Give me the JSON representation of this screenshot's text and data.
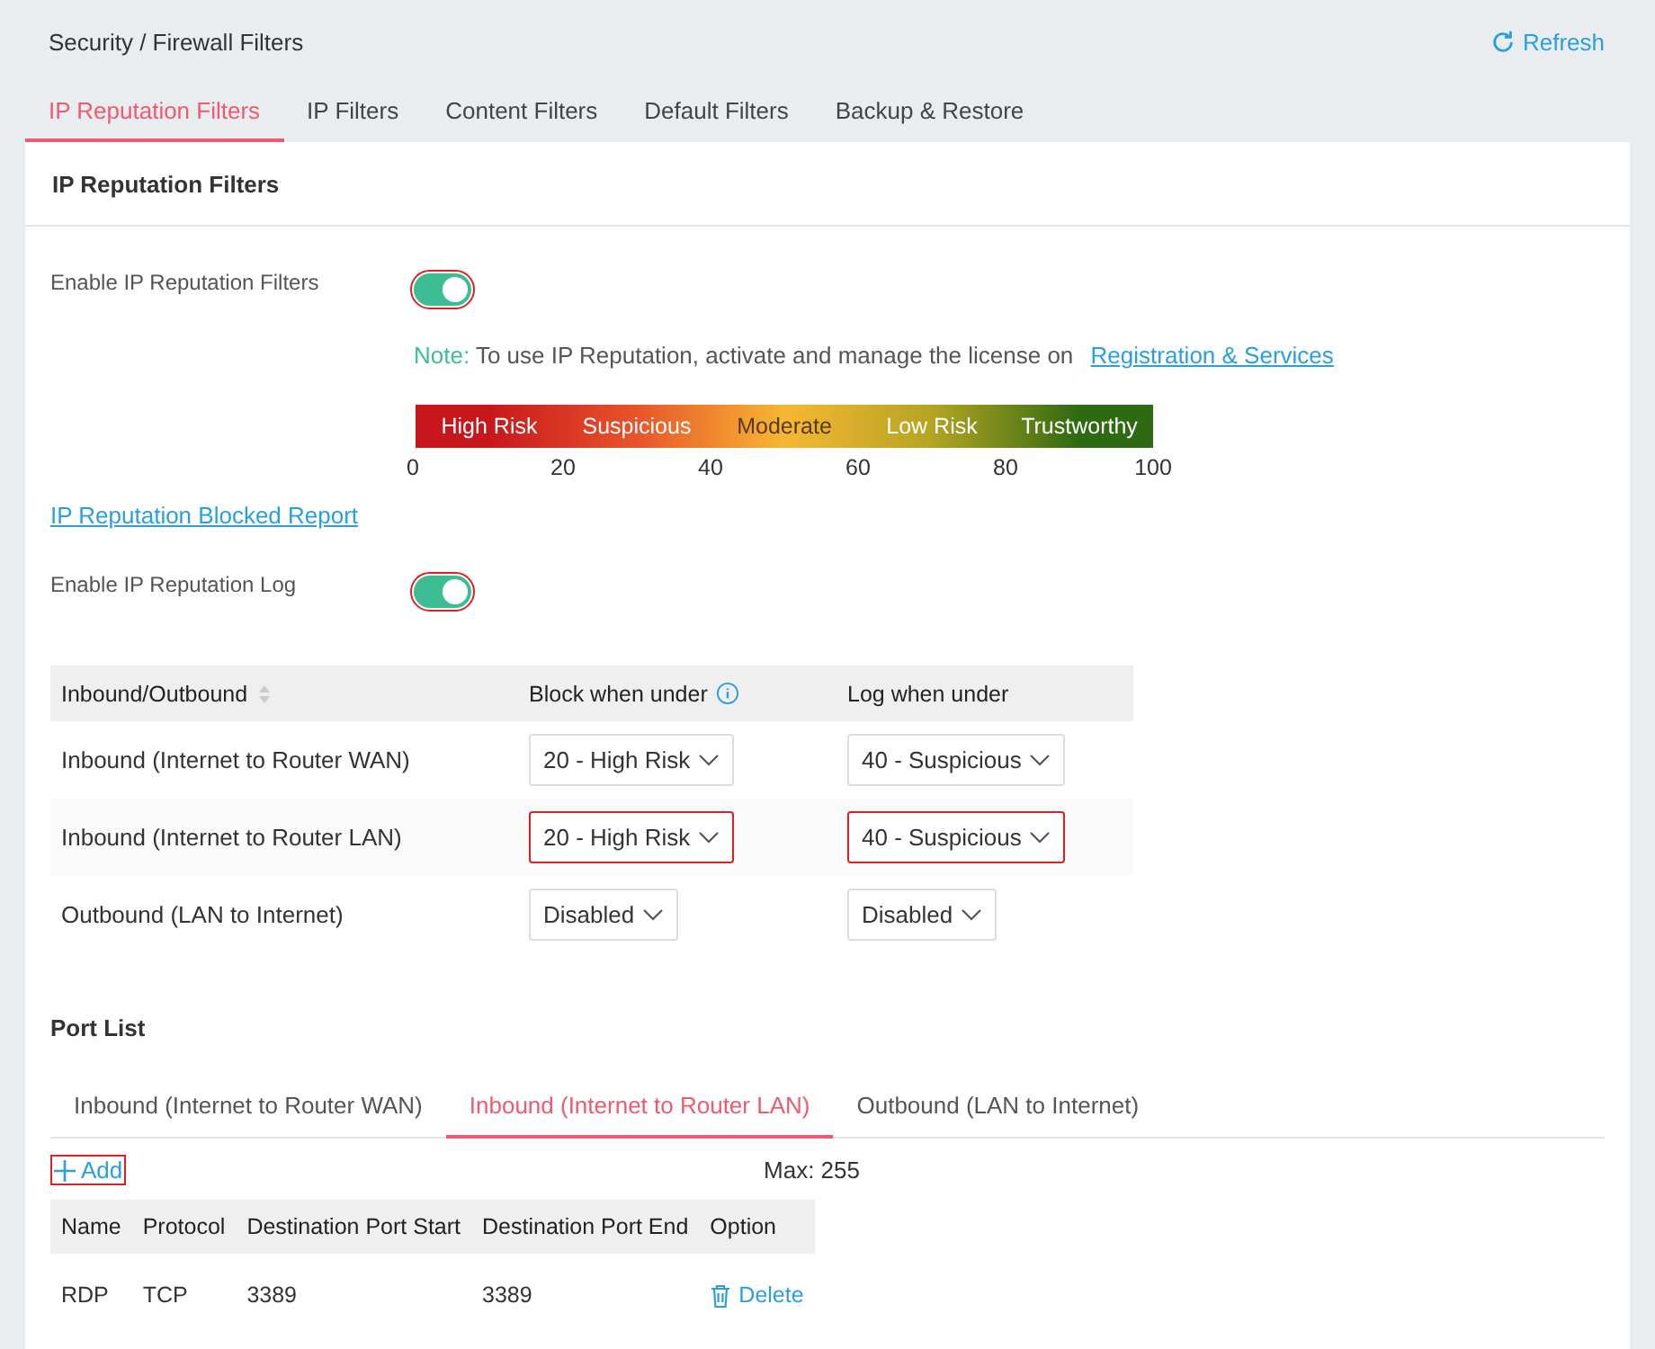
{
  "breadcrumb": "Security / Firewall Filters",
  "refresh": "Refresh",
  "tabs": [
    {
      "label": "IP Reputation Filters",
      "selected": true
    },
    {
      "label": "IP Filters",
      "selected": false
    },
    {
      "label": "Content Filters",
      "selected": false
    },
    {
      "label": "Default Filters",
      "selected": false
    },
    {
      "label": "Backup & Restore",
      "selected": false
    }
  ],
  "panel_title": "IP Reputation Filters",
  "enable_filters": {
    "label": "Enable IP Reputation Filters",
    "on": true,
    "highlighted": true
  },
  "note": {
    "prefix": "Note:",
    "text": "To use IP Reputation, activate and manage the license on",
    "link": "Registration & Services"
  },
  "risk_scale": {
    "segments": [
      {
        "label": "High Risk",
        "color": "#c8161d"
      },
      {
        "label": "Suspicious",
        "color": "#e8542a"
      },
      {
        "label": "Moderate",
        "color": "#f6b733"
      },
      {
        "label": "Low Risk",
        "color": "#b5a423"
      },
      {
        "label": "Trustworthy",
        "color": "#2d6a12"
      }
    ],
    "ticks": [
      "0",
      "20",
      "40",
      "60",
      "80",
      "100"
    ]
  },
  "report_link": "IP Reputation Blocked Report",
  "enable_log": {
    "label": "Enable IP Reputation Log",
    "on": true,
    "highlighted": true
  },
  "rules_table": {
    "columns": [
      "Inbound/Outbound",
      "Block when under",
      "Log when under"
    ],
    "rows": [
      {
        "direction": "Inbound (Internet to Router WAN)",
        "block": {
          "value": "20 - High Risk",
          "highlighted": false
        },
        "log": {
          "value": "40 - Suspicious",
          "highlighted": false
        }
      },
      {
        "direction": "Inbound (Internet to Router LAN)",
        "block": {
          "value": "20 - High Risk",
          "highlighted": true
        },
        "log": {
          "value": "40 - Suspicious",
          "highlighted": true
        }
      },
      {
        "direction": "Outbound (LAN to Internet)",
        "block": {
          "value": "Disabled",
          "highlighted": false
        },
        "log": {
          "value": "Disabled",
          "highlighted": false
        }
      }
    ]
  },
  "port_list": {
    "title": "Port List",
    "tabs": [
      {
        "label": "Inbound (Internet to Router WAN)",
        "selected": false
      },
      {
        "label": "Inbound (Internet to Router LAN)",
        "selected": true
      },
      {
        "label": "Outbound (LAN to Internet)",
        "selected": false
      }
    ],
    "add": {
      "label": "Add",
      "highlighted": true
    },
    "max": "Max: 255",
    "columns": [
      "Name",
      "Protocol",
      "Destination Port Start",
      "Destination Port End",
      "Option"
    ],
    "rows": [
      {
        "name": "RDP",
        "protocol": "TCP",
        "start": "3389",
        "end": "3389",
        "action": "Delete"
      }
    ]
  }
}
